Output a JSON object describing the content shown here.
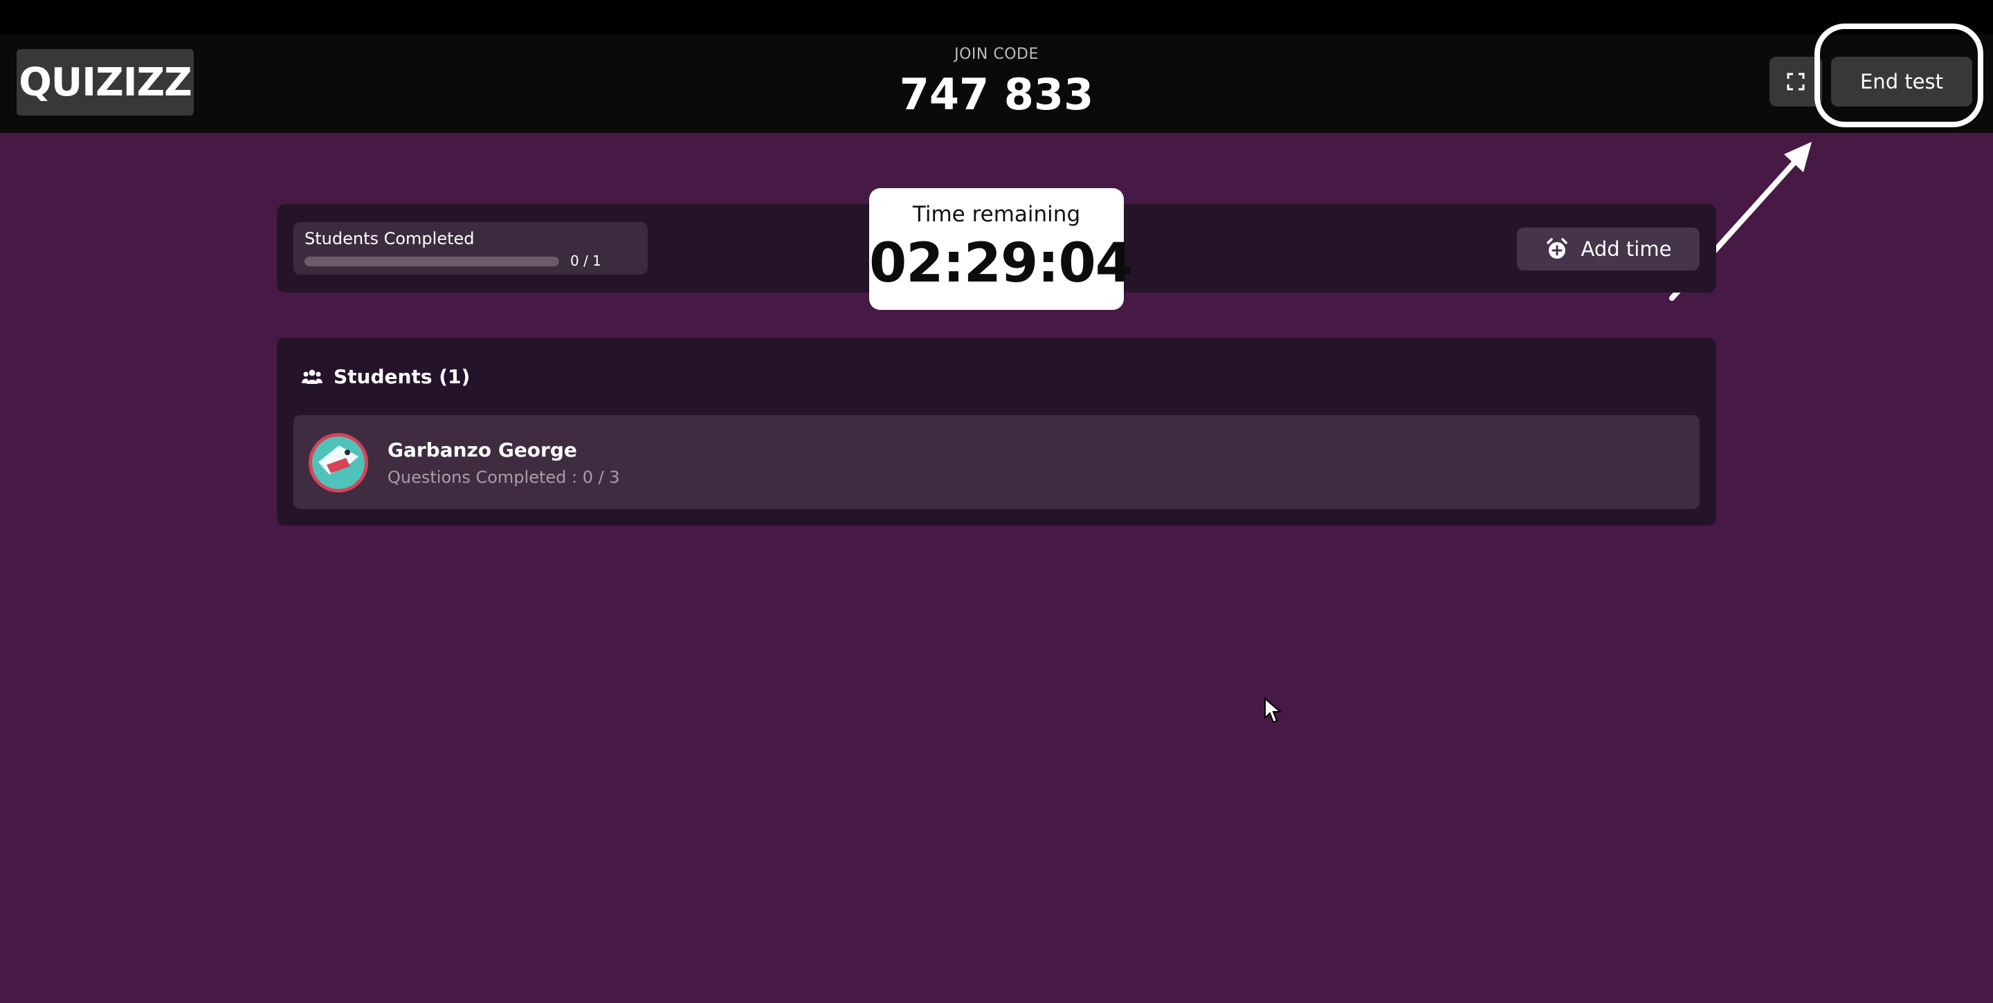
{
  "header": {
    "logo_text": "QUIZIZZ",
    "join_code_label": "JOIN CODE",
    "join_code": "747 833",
    "fullscreen_icon": "fullscreen-icon",
    "end_test_label": "End test"
  },
  "stats": {
    "students_completed_label": "Students Completed",
    "students_completed_count": "0 / 1",
    "students_completed_fraction": 0,
    "add_time_label": "Add time",
    "add_time_icon": "alarm-plus-icon"
  },
  "timer": {
    "label": "Time remaining",
    "value": "02:29:04"
  },
  "students": {
    "heading": "Students (1)",
    "heading_icon": "users-icon",
    "list": [
      {
        "name": "Garbanzo George",
        "progress": "Questions Completed : 0 / 3"
      }
    ]
  },
  "colors": {
    "background": "#461a44",
    "header": "#0a0a0a",
    "panel": "#25132a",
    "button": "#383838",
    "highlight_ring": "#ffffff"
  }
}
